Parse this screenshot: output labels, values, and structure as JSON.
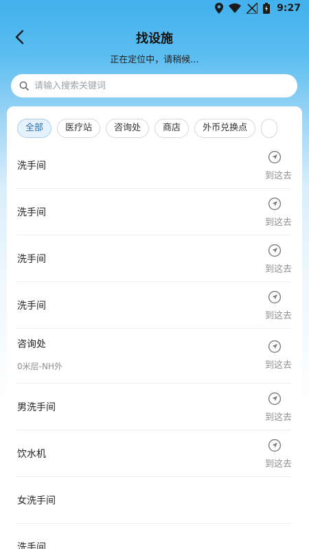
{
  "status": {
    "time": "9:27"
  },
  "header": {
    "title": "找设施",
    "subtitle": "正在定位中，请稍候..."
  },
  "search": {
    "placeholder": "请输入搜索关键词",
    "value": ""
  },
  "chips": [
    {
      "label": "全部",
      "active": true
    },
    {
      "label": "医疗站"
    },
    {
      "label": "咨询处"
    },
    {
      "label": "商店"
    },
    {
      "label": "外币兑换点"
    },
    {
      "label": ""
    }
  ],
  "nav_label": "到这去",
  "facilities": [
    {
      "name": "洗手间",
      "sub": ""
    },
    {
      "name": "洗手间",
      "sub": ""
    },
    {
      "name": "洗手间",
      "sub": ""
    },
    {
      "name": "洗手间",
      "sub": ""
    },
    {
      "name": "咨询处",
      "sub": "0米层-NH外"
    },
    {
      "name": "男洗手间",
      "sub": ""
    },
    {
      "name": "饮水机",
      "sub": ""
    },
    {
      "name": "女洗手间",
      "sub": ""
    },
    {
      "name": "洗手间",
      "sub": ""
    }
  ],
  "colors": {
    "accent": "#2a6fb0",
    "chip_active_bg": "#e6f2fb"
  }
}
